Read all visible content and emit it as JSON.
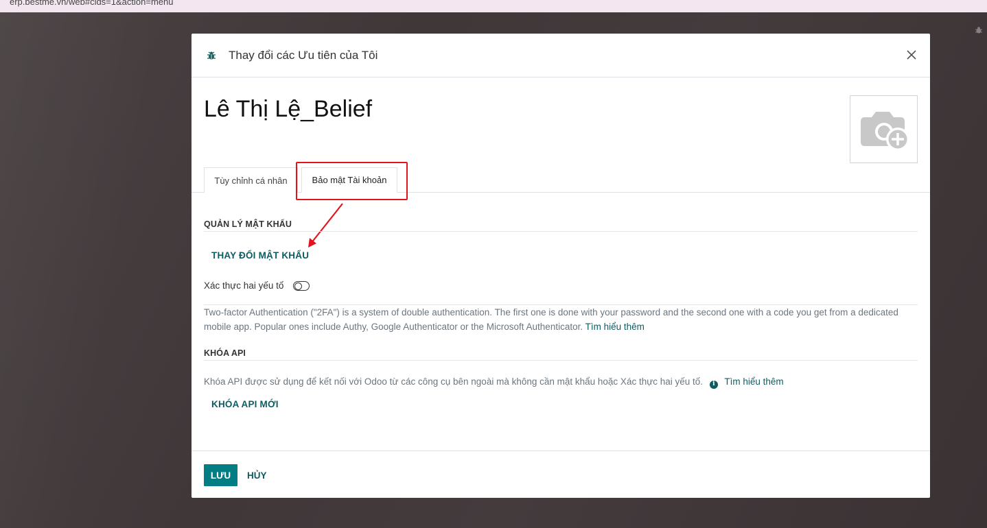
{
  "browser": {
    "url": "erp.bestme.vn/web#cids=1&action=menu"
  },
  "dialog": {
    "title": "Thay đổi các Ưu tiên của Tôi",
    "user_name": "Lê Thị Lệ_Belief",
    "tabs": [
      {
        "label": "Tùy chỉnh cá nhân",
        "active": false
      },
      {
        "label": "Bảo mật Tài khoản",
        "active": true
      }
    ],
    "password": {
      "section_title": "QUẢN LÝ MẬT KHẨU",
      "change_button": "THAY ĐỔI MẬT KHẨU",
      "tfa_label": "Xác thực hai yếu tố",
      "tfa_enabled": false,
      "tfa_description": "Two-factor Authentication (\"2FA\") is a system of double authentication. The first one is done with your password and the second one with a code you get from a dedicated mobile app. Popular ones include Authy, Google Authenticator or the Microsoft Authenticator.",
      "tfa_learn_more": "Tìm hiểu thêm"
    },
    "api": {
      "section_title": "KHÓA API",
      "description": "Khóa API được sử dụng để kết nối với Odoo từ các công cụ bên ngoài mà không cần mật khẩu hoặc Xác thực hai yếu tố.",
      "learn_more": "Tìm hiểu thêm",
      "new_key_button": "KHÓA API MỚI"
    },
    "footer": {
      "save_label": "LƯU",
      "cancel_label": "HỦY"
    }
  },
  "colors": {
    "primary": "#017e84",
    "link": "#0e5b62",
    "annotation": "#e0141e"
  }
}
